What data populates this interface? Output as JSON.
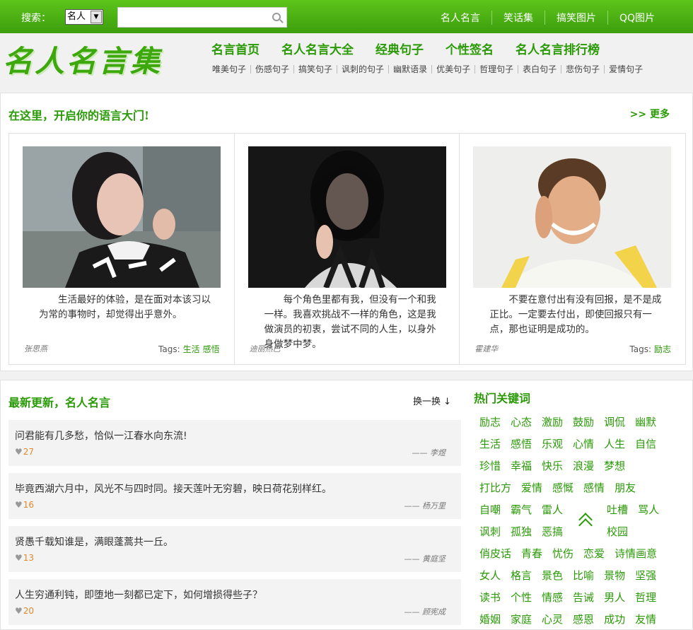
{
  "topbar": {
    "search_label": "搜索：",
    "select_value": "名人",
    "links": [
      "名人名言",
      "笑话集",
      "搞笑图片",
      "QQ图片"
    ]
  },
  "header": {
    "logo": "名人名言集",
    "nav": [
      "名言首页",
      "名人名言大全",
      "经典句子",
      "个性签名",
      "名人名言排行榜"
    ],
    "subnav": [
      "唯美句子",
      "伤感句子",
      "搞笑句子",
      "讽刺的句子",
      "幽默语录",
      "优美句子",
      "哲理句子",
      "表白句子",
      "悲伤句子",
      "爱情句子"
    ]
  },
  "featured": {
    "title": "在这里，开启你的语言大门!",
    "more": ">> 更多",
    "cards": [
      {
        "quote": "生活最好的体验，是在面对本该习以为常的事物时，却觉得出乎意外。",
        "author": "张思燕",
        "tags_label": "Tags:",
        "tags": [
          "生活",
          "感悟"
        ]
      },
      {
        "quote": "每个角色里都有我，但没有一个和我一样。我喜欢挑战不一样的角色，这是我做演员的初衷，尝试不同的人生，以身外身做梦中梦。",
        "author": "迪丽热巴",
        "tags_label": "",
        "tags": []
      },
      {
        "quote": "不要在意付出有没有回报，是不是成正比。一定要去付出，即使回报只有一点，那也证明是成功的。",
        "author": "霍建华",
        "tags_label": "Tags:",
        "tags": [
          "励志"
        ]
      }
    ]
  },
  "latest": {
    "title": "最新更新，名人名言",
    "shuffle": "换一换 ↓",
    "items": [
      {
        "text": "问君能有几多愁，恰似一江春水向东流!",
        "likes": "27",
        "author": "—— 李煜"
      },
      {
        "text": "毕竟西湖六月中，风光不与四时同。接天莲叶无穷碧，映日荷花别样红。",
        "likes": "16",
        "author": "—— 杨万里"
      },
      {
        "text": "贤愚千载知谁是，满眼蓬蒿共一丘。",
        "likes": "13",
        "author": "—— 黄庭坚"
      },
      {
        "text": "人生穷通利钝，即堕地一刻都已定下，如何增损得些子？",
        "likes": "20",
        "author": "—— 顾宪成"
      }
    ]
  },
  "hot": {
    "title": "热门关键词",
    "rows": [
      [
        "励志",
        "心态",
        "激励",
        "鼓励",
        "调侃",
        "幽默"
      ],
      [
        "生活",
        "感悟",
        "乐观",
        "心情",
        "人生",
        "自信"
      ],
      [
        "珍惜",
        "幸福",
        "快乐",
        "浪漫",
        "梦想"
      ],
      [
        "打比方",
        "爱情",
        "感慨",
        "感情",
        "朋友"
      ],
      [
        "自嘲",
        "霸气",
        "雷人",
        "",
        "吐槽",
        "骂人"
      ],
      [
        "讽刺",
        "孤独",
        "恶搞",
        "",
        "校园"
      ],
      [
        "俏皮话",
        "青春",
        "忧伤",
        "恋爱",
        "诗情画意"
      ],
      [
        "女人",
        "格言",
        "景色",
        "比喻",
        "景物",
        "坚强"
      ],
      [
        "读书",
        "个性",
        "情感",
        "告诫",
        "男人",
        "哲理"
      ],
      [
        "婚姻",
        "家庭",
        "心灵",
        "感恩",
        "成功",
        "友情"
      ]
    ]
  },
  "colors": {
    "brand": "#3e9e0e",
    "accent": "#2a9a06",
    "likes": "#e0882c"
  }
}
